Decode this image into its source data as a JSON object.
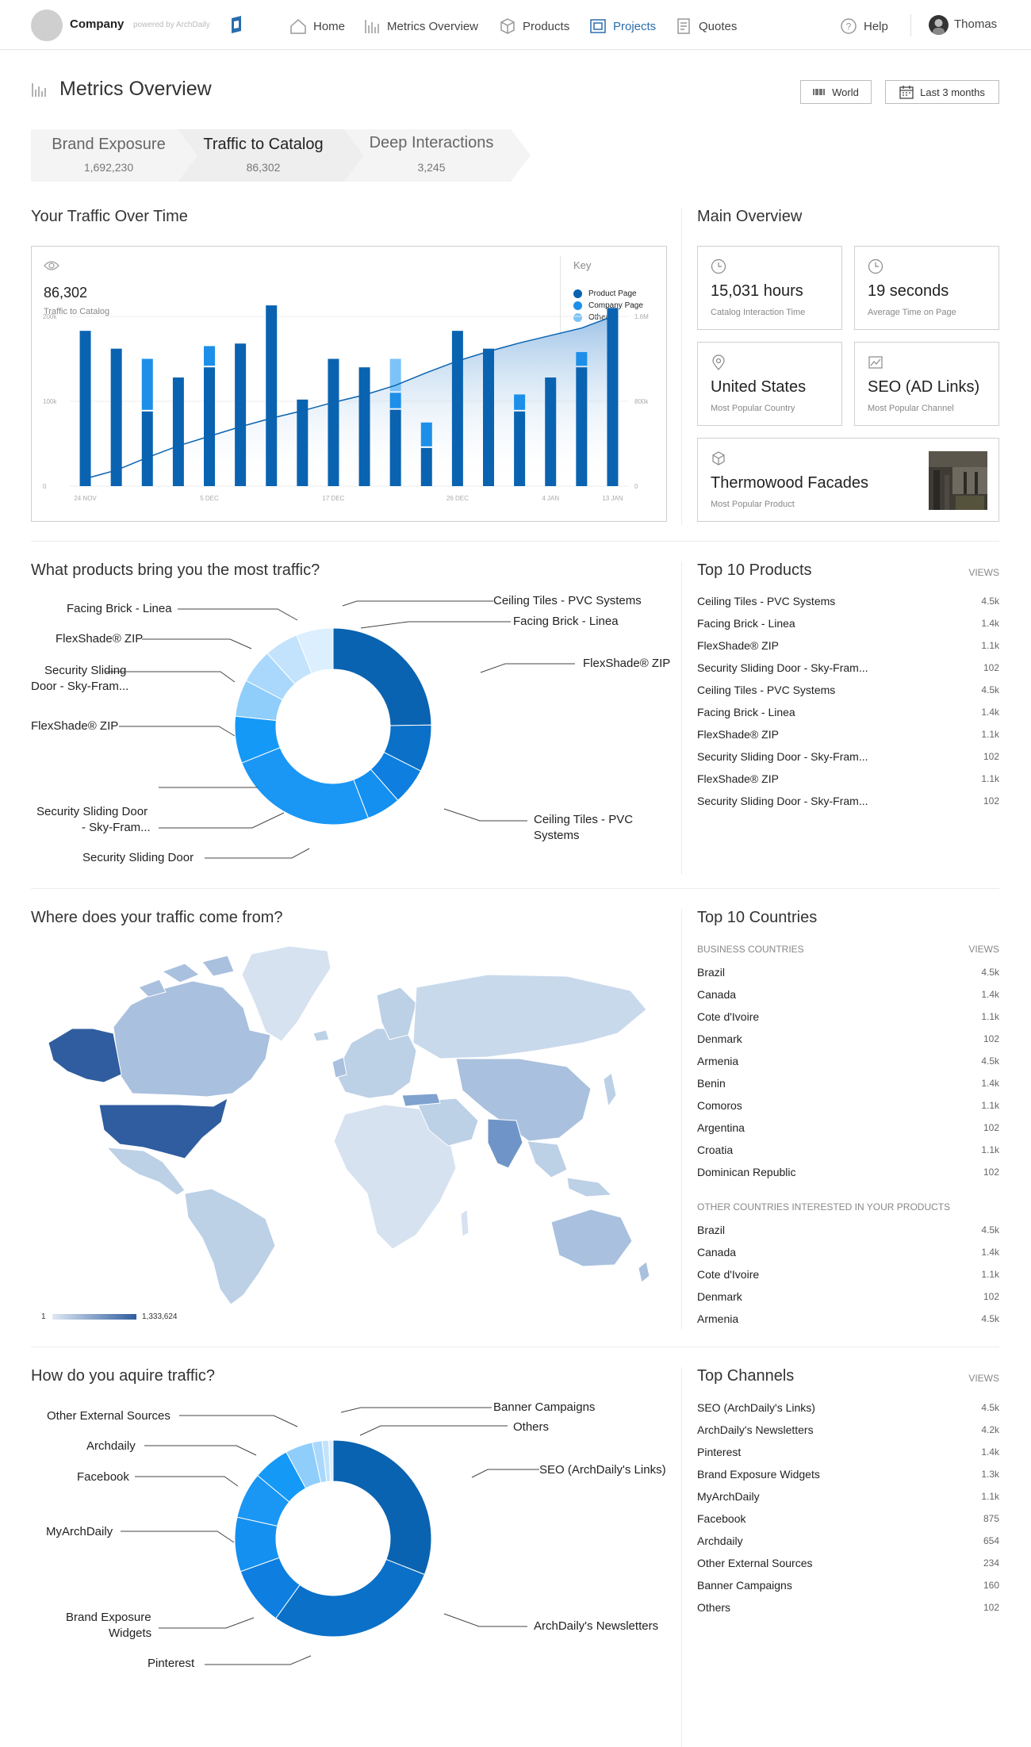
{
  "nav": {
    "company": "Company",
    "powered_by": "powered by ArchDaily",
    "items": [
      {
        "label": "Home",
        "icon": "home-icon"
      },
      {
        "label": "Metrics Overview",
        "icon": "bar-chart-icon"
      },
      {
        "label": "Products",
        "icon": "cube-icon"
      },
      {
        "label": "Projects",
        "icon": "projects-icon"
      },
      {
        "label": "Quotes",
        "icon": "document-icon"
      }
    ],
    "help": "Help",
    "user": "Thomas",
    "active_color": "#2a6dad"
  },
  "header": {
    "title": "Metrics Overview",
    "region_button": "World",
    "date_button": "Last 3 months"
  },
  "funnel": [
    {
      "label": "Brand Exposure",
      "value": "1,692,230"
    },
    {
      "label": "Traffic to Catalog",
      "value": "86,302"
    },
    {
      "label": "Deep Interactions",
      "value": "3,245"
    }
  ],
  "traffic": {
    "title": "Your Traffic Over Time",
    "total": "86,302",
    "total_label": "Traffic to Catalog",
    "key_title": "Key",
    "chart_data": {
      "type": "bar",
      "x_ticks": [
        "24 NOV",
        "5 DEC",
        "17 DEC",
        "26 DEC",
        "4 JAN",
        "13 JAN"
      ],
      "y_left_ticks": [
        "200k",
        "100k",
        "0"
      ],
      "y_right_ticks": [
        "1.6M",
        "800k",
        "0"
      ],
      "ylim": [
        0,
        200000
      ],
      "series": [
        {
          "name": "Product Page",
          "color": "#0a63b0",
          "values": [
            183000,
            162000,
            88000,
            128000,
            140000,
            168000,
            213000,
            102000,
            150000,
            140000,
            90000,
            45000,
            183000,
            162000,
            88000,
            128000,
            140000,
            210000
          ]
        },
        {
          "name": "Company Page",
          "color": "#1d8fe8",
          "values": [
            0,
            0,
            62000,
            0,
            25000,
            0,
            0,
            0,
            0,
            0,
            20000,
            30000,
            0,
            0,
            20000,
            0,
            18000,
            0
          ]
        },
        {
          "name": "Other",
          "color": "#7cc3f7",
          "values": [
            0,
            0,
            0,
            0,
            0,
            0,
            0,
            0,
            0,
            0,
            40000,
            0,
            0,
            0,
            0,
            0,
            0,
            0
          ]
        }
      ],
      "cumulative_line": {
        "name": "Cumulative",
        "ylim": [
          0,
          1600000
        ],
        "values": [
          70000,
          150000,
          270000,
          380000,
          470000,
          560000,
          640000,
          710000,
          790000,
          860000,
          950000,
          1070000,
          1180000,
          1270000,
          1350000,
          1420000,
          1490000,
          1600000
        ]
      }
    }
  },
  "overview": {
    "title": "Main Overview",
    "cards": [
      {
        "value": "15,031 hours",
        "label": "Catalog Interaction Time",
        "icon": "clock-icon"
      },
      {
        "value": "19 seconds",
        "label": "Average Time on Page",
        "icon": "clock-icon"
      },
      {
        "value": "United States",
        "label": "Most Popular Country",
        "icon": "map-pin-icon"
      },
      {
        "value": "SEO (AD Links)",
        "label": "Most Popular Channel",
        "icon": "image-chart-icon"
      },
      {
        "value": "Thermowood Facades",
        "label": "Most Popular Product",
        "icon": "cube-icon"
      }
    ]
  },
  "products_chart": {
    "title": "What products bring you the most traffic?",
    "chart_data": {
      "type": "pie",
      "slices": [
        {
          "label": "Ceiling Tiles - PVC Systems",
          "value": 4.5
        },
        {
          "label": "Facing Brick - Linea",
          "value": 1.4
        },
        {
          "label": "FlexShade® ZIP",
          "value": 1.1
        },
        {
          "label": "Security Sliding Door - Sky-Fram...",
          "value": 1.02
        },
        {
          "label": "Ceiling Tiles - PVC Systems",
          "value": 4.5
        },
        {
          "label": "Facing Brick - Linea",
          "value": 1.4
        },
        {
          "label": "FlexShade® ZIP",
          "value": 1.1
        },
        {
          "label": "Security Sliding Door",
          "value": 1.02
        },
        {
          "label": "Security Sliding Door - Sky-Fram...",
          "value": 1.02
        },
        {
          "label": "FlexShade® ZIP",
          "value": 1.1
        }
      ]
    },
    "labels": {
      "facing_left": "Facing Brick - Linea",
      "flex_top": "FlexShade® ZIP",
      "sec_top_1": "Security Sliding",
      "sec_top_2": "Door - Sky-Fram...",
      "flex_mid": "FlexShade® ZIP",
      "sec_bot_1": "Security Sliding Door",
      "sec_bot_2": "- Sky-Fram...",
      "sec_low": "Security Sliding Door",
      "ceiling_top": "Ceiling Tiles - PVC Systems",
      "facing_right": "Facing Brick - Linea",
      "flex_right": "FlexShade® ZIP",
      "ceiling_bot_1": "Ceiling Tiles - PVC",
      "ceiling_bot_2": "Systems"
    }
  },
  "top_products": {
    "title": "Top 10 Products",
    "views_label": "VIEWS",
    "rows": [
      {
        "name": "Ceiling Tiles - PVC Systems",
        "views": "4.5k"
      },
      {
        "name": "Facing Brick - Linea",
        "views": "1.4k"
      },
      {
        "name": "FlexShade® ZIP",
        "views": "1.1k"
      },
      {
        "name": "Security Sliding Door - Sky-Fram...",
        "views": "102"
      },
      {
        "name": "Ceiling Tiles - PVC Systems",
        "views": "4.5k"
      },
      {
        "name": "Facing Brick - Linea",
        "views": "1.4k"
      },
      {
        "name": "FlexShade® ZIP",
        "views": "1.1k"
      },
      {
        "name": "Security Sliding Door - Sky-Fram...",
        "views": "102"
      },
      {
        "name": "FlexShade® ZIP",
        "views": "1.1k"
      },
      {
        "name": "Security Sliding Door - Sky-Fram...",
        "views": "102"
      }
    ]
  },
  "map": {
    "title": "Where does your traffic come from?",
    "scale_min": "1",
    "scale_max": "1,333,624"
  },
  "top_countries": {
    "title": "Top 10 Countries",
    "business_label": "BUSINESS COUNTRIES",
    "views_label": "VIEWS",
    "business": [
      {
        "name": "Brazil",
        "views": "4.5k"
      },
      {
        "name": "Canada",
        "views": "1.4k"
      },
      {
        "name": "Cote d'Ivoire",
        "views": "1.1k"
      },
      {
        "name": "Denmark",
        "views": "102"
      },
      {
        "name": "Armenia",
        "views": "4.5k"
      },
      {
        "name": "Benin",
        "views": "1.4k"
      },
      {
        "name": "Comoros",
        "views": "1.1k"
      },
      {
        "name": "Argentina",
        "views": "102"
      },
      {
        "name": "Croatia",
        "views": "1.1k"
      },
      {
        "name": "Dominican Republic",
        "views": "102"
      }
    ],
    "other_label": "OTHER COUNTRIES INTERESTED IN YOUR PRODUCTS",
    "other": [
      {
        "name": "Brazil",
        "views": "4.5k"
      },
      {
        "name": "Canada",
        "views": "1.4k"
      },
      {
        "name": "Cote d'Ivoire",
        "views": "1.1k"
      },
      {
        "name": "Denmark",
        "views": "102"
      },
      {
        "name": "Armenia",
        "views": "4.5k"
      }
    ]
  },
  "channels_chart": {
    "title": "How do you aquire traffic?",
    "chart_data": {
      "type": "pie",
      "slices": [
        {
          "label": "SEO (ArchDaily's Links)",
          "value": 4.5
        },
        {
          "label": "ArchDaily's Newsletters",
          "value": 4.2
        },
        {
          "label": "Pinterest",
          "value": 1.4
        },
        {
          "label": "Brand Exposure Widgets",
          "value": 1.3
        },
        {
          "label": "MyArchDaily",
          "value": 1.1
        },
        {
          "label": "Facebook",
          "value": 0.875
        },
        {
          "label": "Archdaily",
          "value": 0.654
        },
        {
          "label": "Other External Sources",
          "value": 0.234
        },
        {
          "label": "Banner Campaigns",
          "value": 0.16
        },
        {
          "label": "Others",
          "value": 0.102
        }
      ]
    },
    "labels": {
      "other_ext": "Other External Sources",
      "archdaily": "Archdaily",
      "facebook": "Facebook",
      "myarch": "MyArchDaily",
      "brand_1": "Brand Exposure",
      "brand_2": "Widgets",
      "pinterest": "Pinterest",
      "banner": "Banner Campaigns",
      "others": "Others",
      "seo": "SEO (ArchDaily's Links)",
      "newsletters": "ArchDaily's Newsletters"
    }
  },
  "top_channels": {
    "title": "Top Channels",
    "views_label": "VIEWS",
    "rows": [
      {
        "name": "SEO (ArchDaily's Links)",
        "views": "4.5k"
      },
      {
        "name": "ArchDaily's Newsletters",
        "views": "4.2k"
      },
      {
        "name": "Pinterest",
        "views": "1.4k"
      },
      {
        "name": "Brand Exposure Widgets",
        "views": "1.3k"
      },
      {
        "name": "MyArchDaily",
        "views": "1.1k"
      },
      {
        "name": "Facebook",
        "views": "875"
      },
      {
        "name": "Archdaily",
        "views": "654"
      },
      {
        "name": "Other External Sources",
        "views": "234"
      },
      {
        "name": "Banner Campaigns",
        "views": "160"
      },
      {
        "name": "Others",
        "views": "102"
      }
    ]
  }
}
